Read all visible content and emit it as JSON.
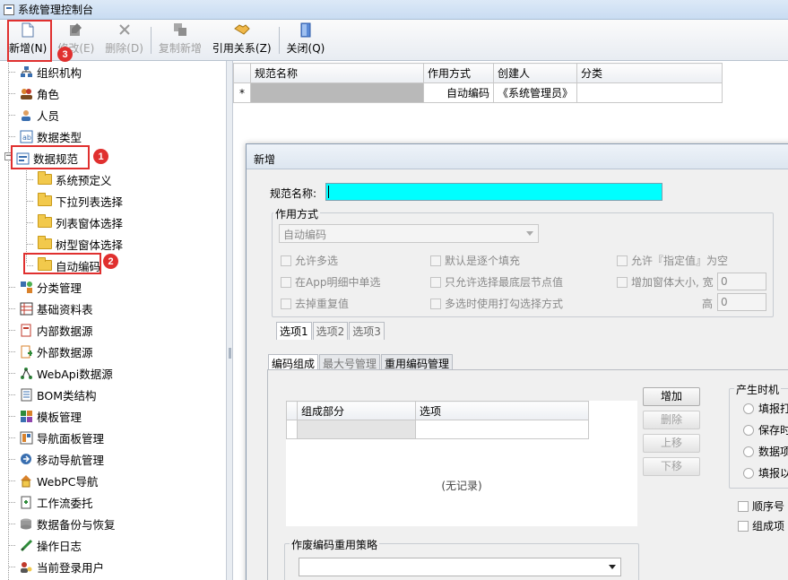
{
  "window": {
    "title": "系统管理控制台"
  },
  "toolbar": {
    "new_label": "新增(N)",
    "edit_label": "修改(E)",
    "delete_label": "删除(D)",
    "copy_new_label": "复制新增",
    "ref_label": "引用关系(Z)",
    "close_label": "关闭(Q)"
  },
  "badges": {
    "b1": "1",
    "b2": "2",
    "b3": "3"
  },
  "tree": {
    "items": [
      "组织机构",
      "角色",
      "人员",
      "数据类型",
      "数据规范",
      "系统预定义",
      "下拉列表选择",
      "列表窗体选择",
      "树型窗体选择",
      "自动编码",
      "分类管理",
      "基础资料表",
      "内部数据源",
      "外部数据源",
      "WebApi数据源",
      "BOM类结构",
      "模板管理",
      "导航面板管理",
      "移动导航管理",
      "WebPC导航",
      "工作流委托",
      "数据备份与恢复",
      "操作日志",
      "当前登录用户"
    ]
  },
  "grid": {
    "columns": [
      "规范名称",
      "作用方式",
      "创建人",
      "分类"
    ],
    "row_marker": "*",
    "row": {
      "name": "",
      "mode": "自动编码",
      "creator": "《系统管理员》",
      "category": ""
    }
  },
  "dialog": {
    "title": "新增",
    "name_label": "规范名称:",
    "mode_group": "作用方式",
    "mode_value": "自动编码",
    "checks": {
      "allow_multi": "允许多选",
      "default_fill": "默认是逐个填充",
      "allow_specified_empty": "允许『指定值』为空",
      "app_detail_single": "在App明细中单选",
      "only_bottom_node": "只允许选择最底层节点值",
      "enlarge_window": "增加窗体大小, 宽",
      "dedupe": "去掉重复值",
      "multi_checkbox": "多选时使用打勾选择方式"
    },
    "height_label": "高",
    "width_value": "0",
    "height_value": "0",
    "option_tabs": [
      "选项1",
      "选项2",
      "选项3"
    ],
    "main_tabs": [
      "编码组成",
      "最大号管理",
      "重用编码管理"
    ],
    "inner_columns": [
      "组成部分",
      "选项"
    ],
    "no_record": "(无记录)",
    "buttons": {
      "add": "增加",
      "delete": "删除",
      "up": "上移",
      "down": "下移"
    },
    "timing_group": "产生时机",
    "timing_options": [
      "填报打",
      "保存时",
      "数据项",
      "填报以"
    ],
    "seq_check": "顺序号",
    "compose_check": "组成项",
    "reuse_group": "作废编码重用策略",
    "reuse_value": ""
  }
}
